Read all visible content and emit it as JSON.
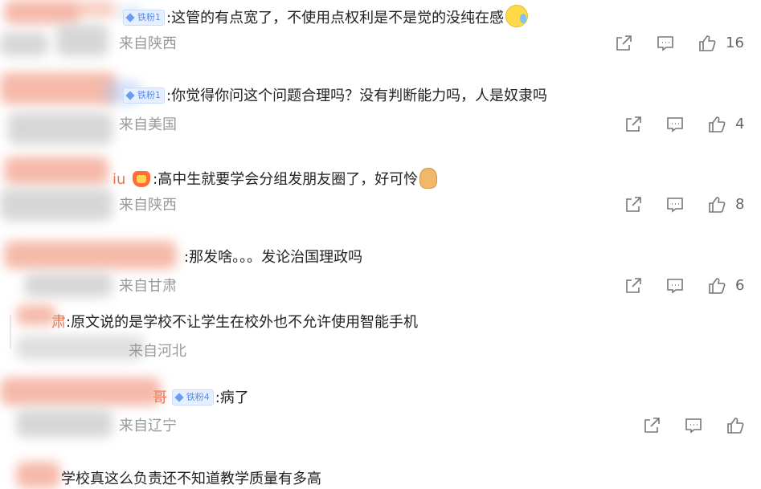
{
  "comments": [
    {
      "badge": "铁粉1",
      "text": ":这管的有点宽了，不使用点权利是不是觉的没纯在感",
      "location": "来自陕西",
      "likes": "16",
      "emoji": "sweat-smile-icon"
    },
    {
      "badge": "铁粉1",
      "text": ":你觉得你问这个问题合理吗？没有判断能力吗，人是奴隶吗",
      "location": "来自美国",
      "likes": "4"
    },
    {
      "username_fragment": "iu",
      "text": ":高中生就要学会分组发朋友圈了，好可怜",
      "location": "来自陕西",
      "likes": "8",
      "emoji": "sad-kid-icon"
    },
    {
      "text": ":那发啥。。。发论治国理政吗",
      "location": "来自甘肃",
      "likes": "6"
    },
    {
      "username_fragment": "肃",
      "text": ":原文说的是学校不让学生在校外也不允许使用智能手机",
      "location": "来自河北"
    },
    {
      "username_fragment": "哥",
      "badge": "铁粉4",
      "text": ":病了",
      "location": "来自辽宁",
      "likes": ""
    },
    {
      "text": "学校真这么负责还不知道教学质量有多高"
    }
  ]
}
